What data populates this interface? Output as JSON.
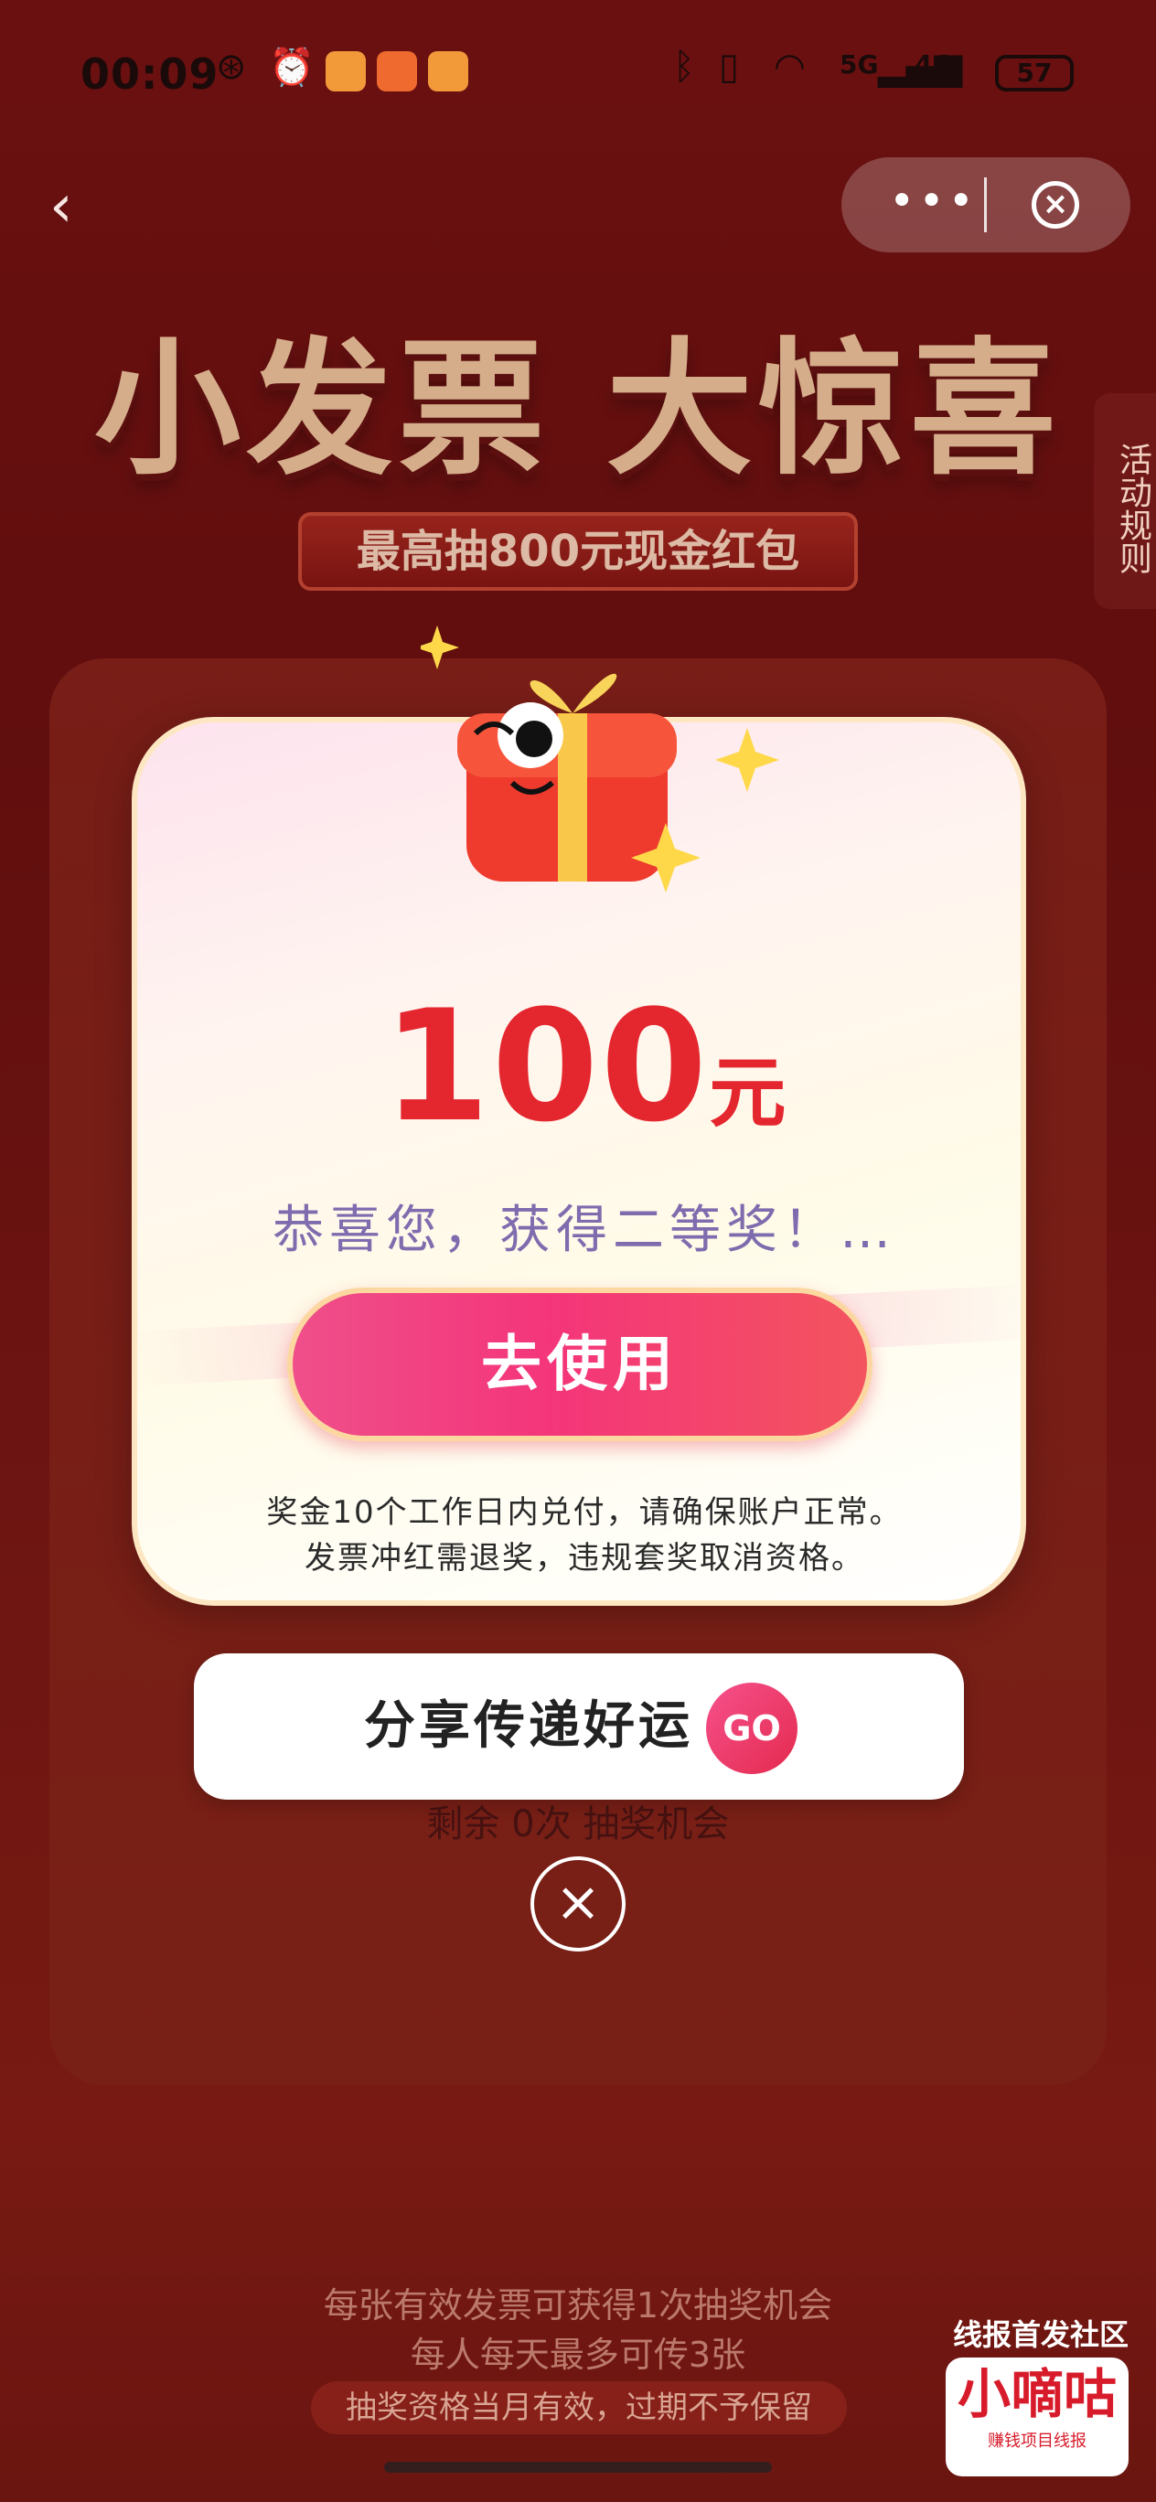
{
  "status_bar": {
    "time": "00:09",
    "battery": "57",
    "signal_5g": "5G",
    "signal_4g": "4G"
  },
  "nav": {
    "back_icon": "chevron-left-icon",
    "more_icon": "more-dots-icon",
    "close_icon": "close-circle-icon"
  },
  "background": {
    "title": "小发票 大惊喜",
    "subtitle": "最高抽800元现金红包",
    "rules_tab": "活动规则",
    "remaining": "剩余 0次 抽奖机会",
    "note_1": "每张有效发票可获得1次抽奖机会",
    "note_2": "每人每天最多可传3张",
    "note_3": "抽奖资格当月有效，过期不予保留",
    "community": "线报首发社区",
    "logo_main": "小嘀咕",
    "logo_sub": "赚钱项目线报"
  },
  "modal": {
    "amount": "100",
    "unit": "元",
    "congrats": "恭喜您，获得二等奖！…",
    "use_button": "去使用",
    "note_line1": "奖金10个工作日内兑付，请确保账户正常。",
    "note_line2": "发票冲红需退奖，违规套奖取消资格。"
  },
  "share": {
    "label": "分享传递好运",
    "go": "GO"
  },
  "colors": {
    "amount": "#e4262f",
    "congrats": "#7e6cae",
    "button_start": "#ef4f8a",
    "button_end": "#f3545e",
    "background": "#7a1414"
  }
}
